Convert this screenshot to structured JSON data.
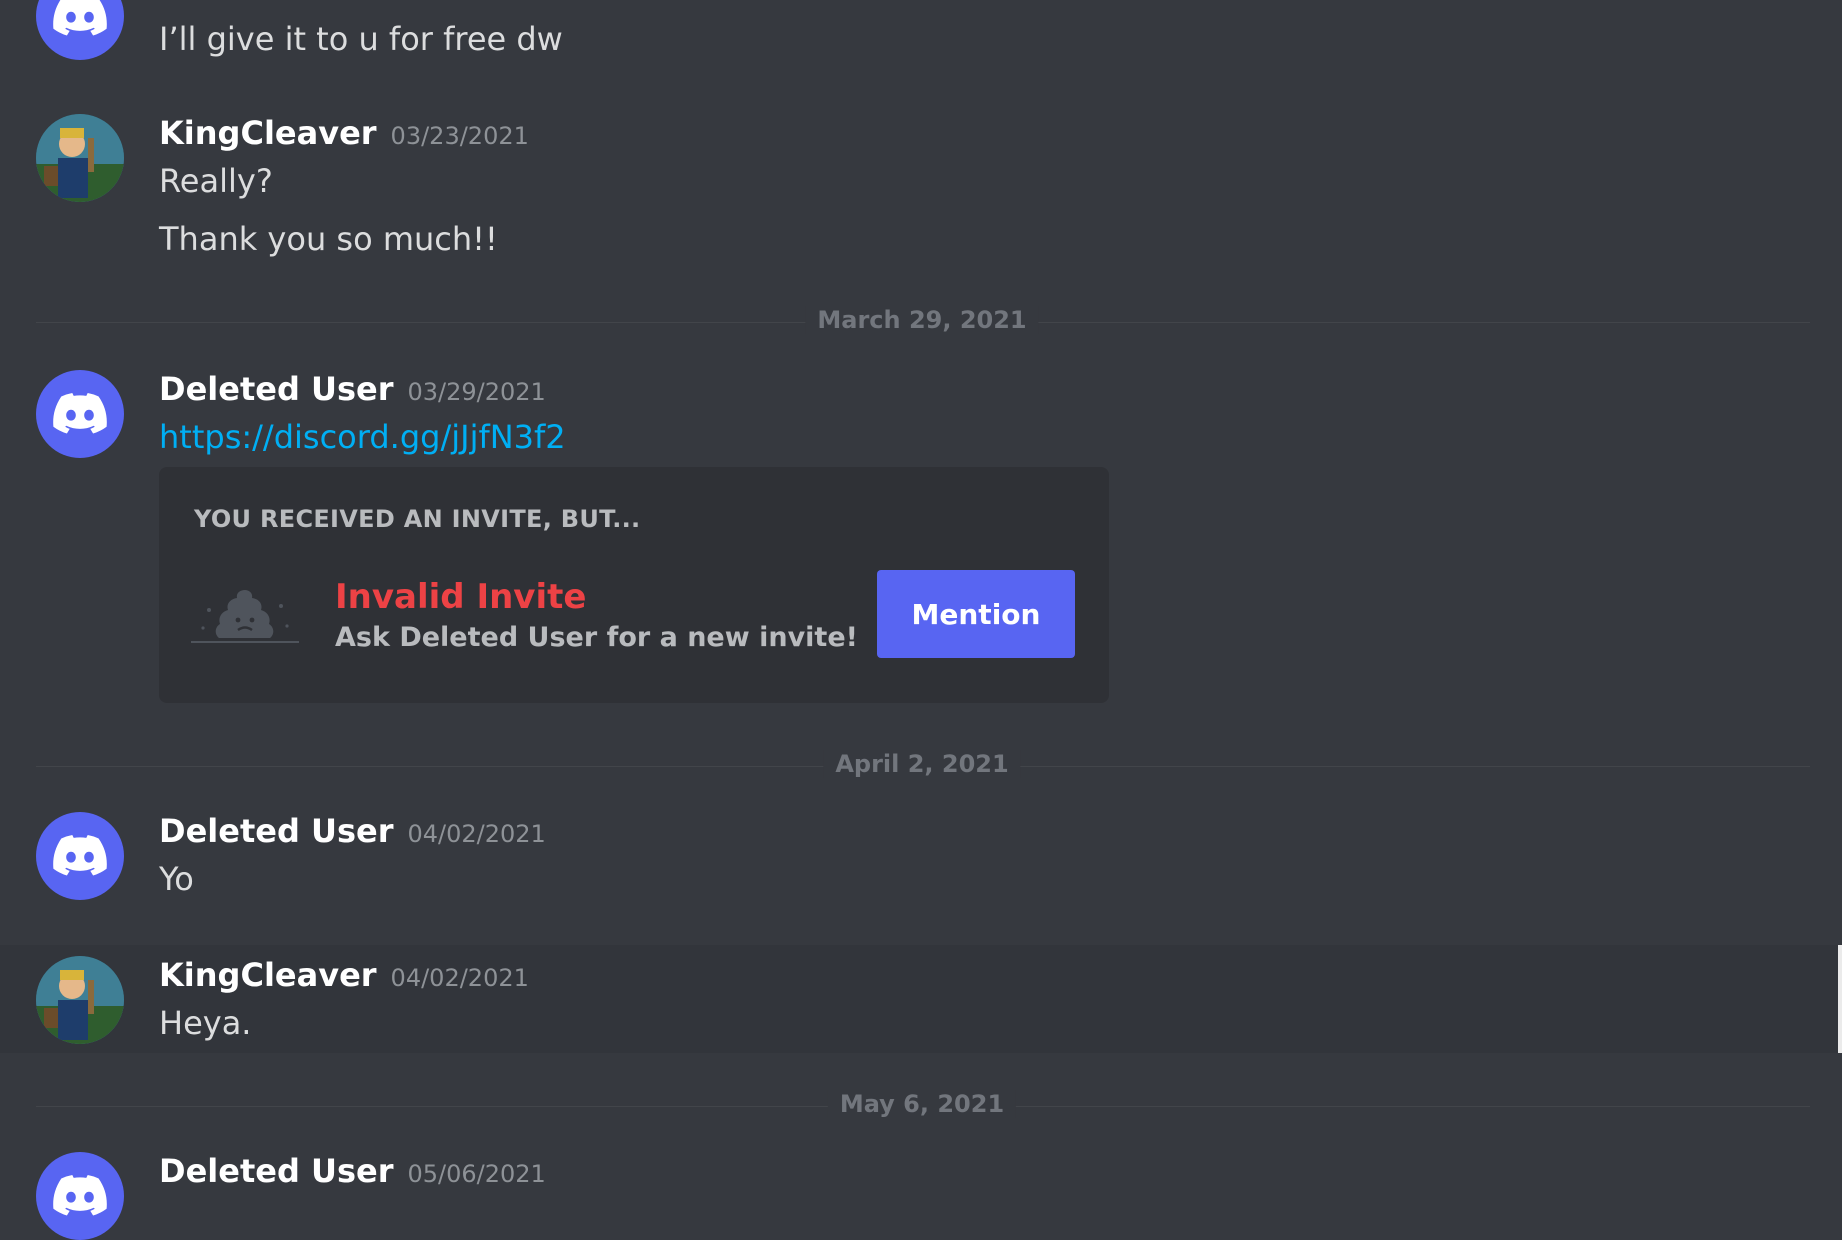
{
  "messages": [
    {
      "text": "I’ll give it to u for free dw"
    },
    {
      "author": "KingCleaver",
      "timestamp": "03/23/2021",
      "lines": [
        "Really?",
        "Thank you so much!!"
      ]
    },
    {
      "author": "Deleted User",
      "timestamp": "03/29/2021",
      "link": "https://discord.gg/jJjfN3f2"
    },
    {
      "author": "Deleted User",
      "timestamp": "04/02/2021",
      "text": "Yo"
    },
    {
      "author": "KingCleaver",
      "timestamp": "04/02/2021",
      "text": "Heya."
    },
    {
      "author": "Deleted User",
      "timestamp": "05/06/2021"
    }
  ],
  "dividers": [
    "March 29, 2021",
    "April 2, 2021",
    "May 6, 2021"
  ],
  "invite": {
    "header": "YOU RECEIVED AN INVITE, BUT...",
    "title": "Invalid Invite",
    "subtitle": "Ask Deleted User for a new invite!",
    "button_label": "Mention"
  },
  "colors": {
    "background": "#36393f",
    "blurple": "#5865f2",
    "link": "#00aff4",
    "invalid_red": "#ed4245"
  },
  "icons": [
    "discord-logo-icon",
    "sad-poop-icon"
  ]
}
